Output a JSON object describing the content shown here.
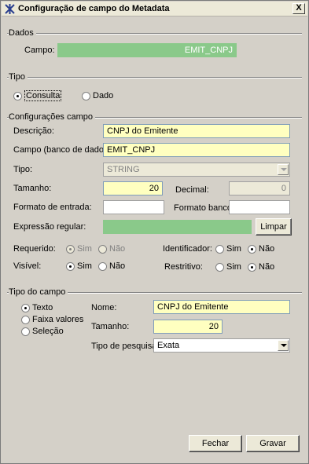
{
  "window": {
    "title": "Configuração de campo do Metadata",
    "close": "X"
  },
  "dados": {
    "section": "Dados",
    "campo_label": "Campo:",
    "campo_value": "EMIT_CNPJ"
  },
  "tipo": {
    "section": "Tipo",
    "consulta": "Consulta",
    "dado": "Dado",
    "selected": "Consulta"
  },
  "config": {
    "section": "Configurações campo",
    "descricao_label": "Descrição:",
    "descricao_value": "CNPJ do Emitente",
    "campo_bd_label": "Campo (banco de dados):",
    "campo_bd_value": "EMIT_CNPJ",
    "tipo_label": "Tipo:",
    "tipo_value": "STRING",
    "tamanho_label": "Tamanho:",
    "tamanho_value": "20",
    "decimal_label": "Decimal:",
    "decimal_value": "0",
    "formato_entrada_label": "Formato de entrada:",
    "formato_entrada_value": "",
    "formato_banco_label": "Formato banco:",
    "formato_banco_value": "",
    "expressao_label": "Expressão regular:",
    "expressao_value": "",
    "limpar_label": "Limpar",
    "requerido_label": "Requerido:",
    "visivel_label": "Visível:",
    "identificador_label": "Identificador:",
    "restritivo_label": "Restritivo:",
    "sim": "Sim",
    "nao": "Não"
  },
  "tipo_campo": {
    "section": "Tipo do campo",
    "options": [
      "Texto",
      "Faixa valores",
      "Seleção"
    ],
    "selected": "Texto",
    "nome_label": "Nome:",
    "nome_value": "CNPJ do Emitente",
    "tamanho_label": "Tamanho:",
    "tamanho_value": "20",
    "pesquisa_label": "Tipo de pesquisa:",
    "pesquisa_value": "Exata"
  },
  "footer": {
    "fechar": "Fechar",
    "gravar": "Gravar"
  },
  "colors": {
    "window_bg": "#d4d0c8",
    "field_yellow": "#ffffc0",
    "field_green": "#8ac98a"
  }
}
